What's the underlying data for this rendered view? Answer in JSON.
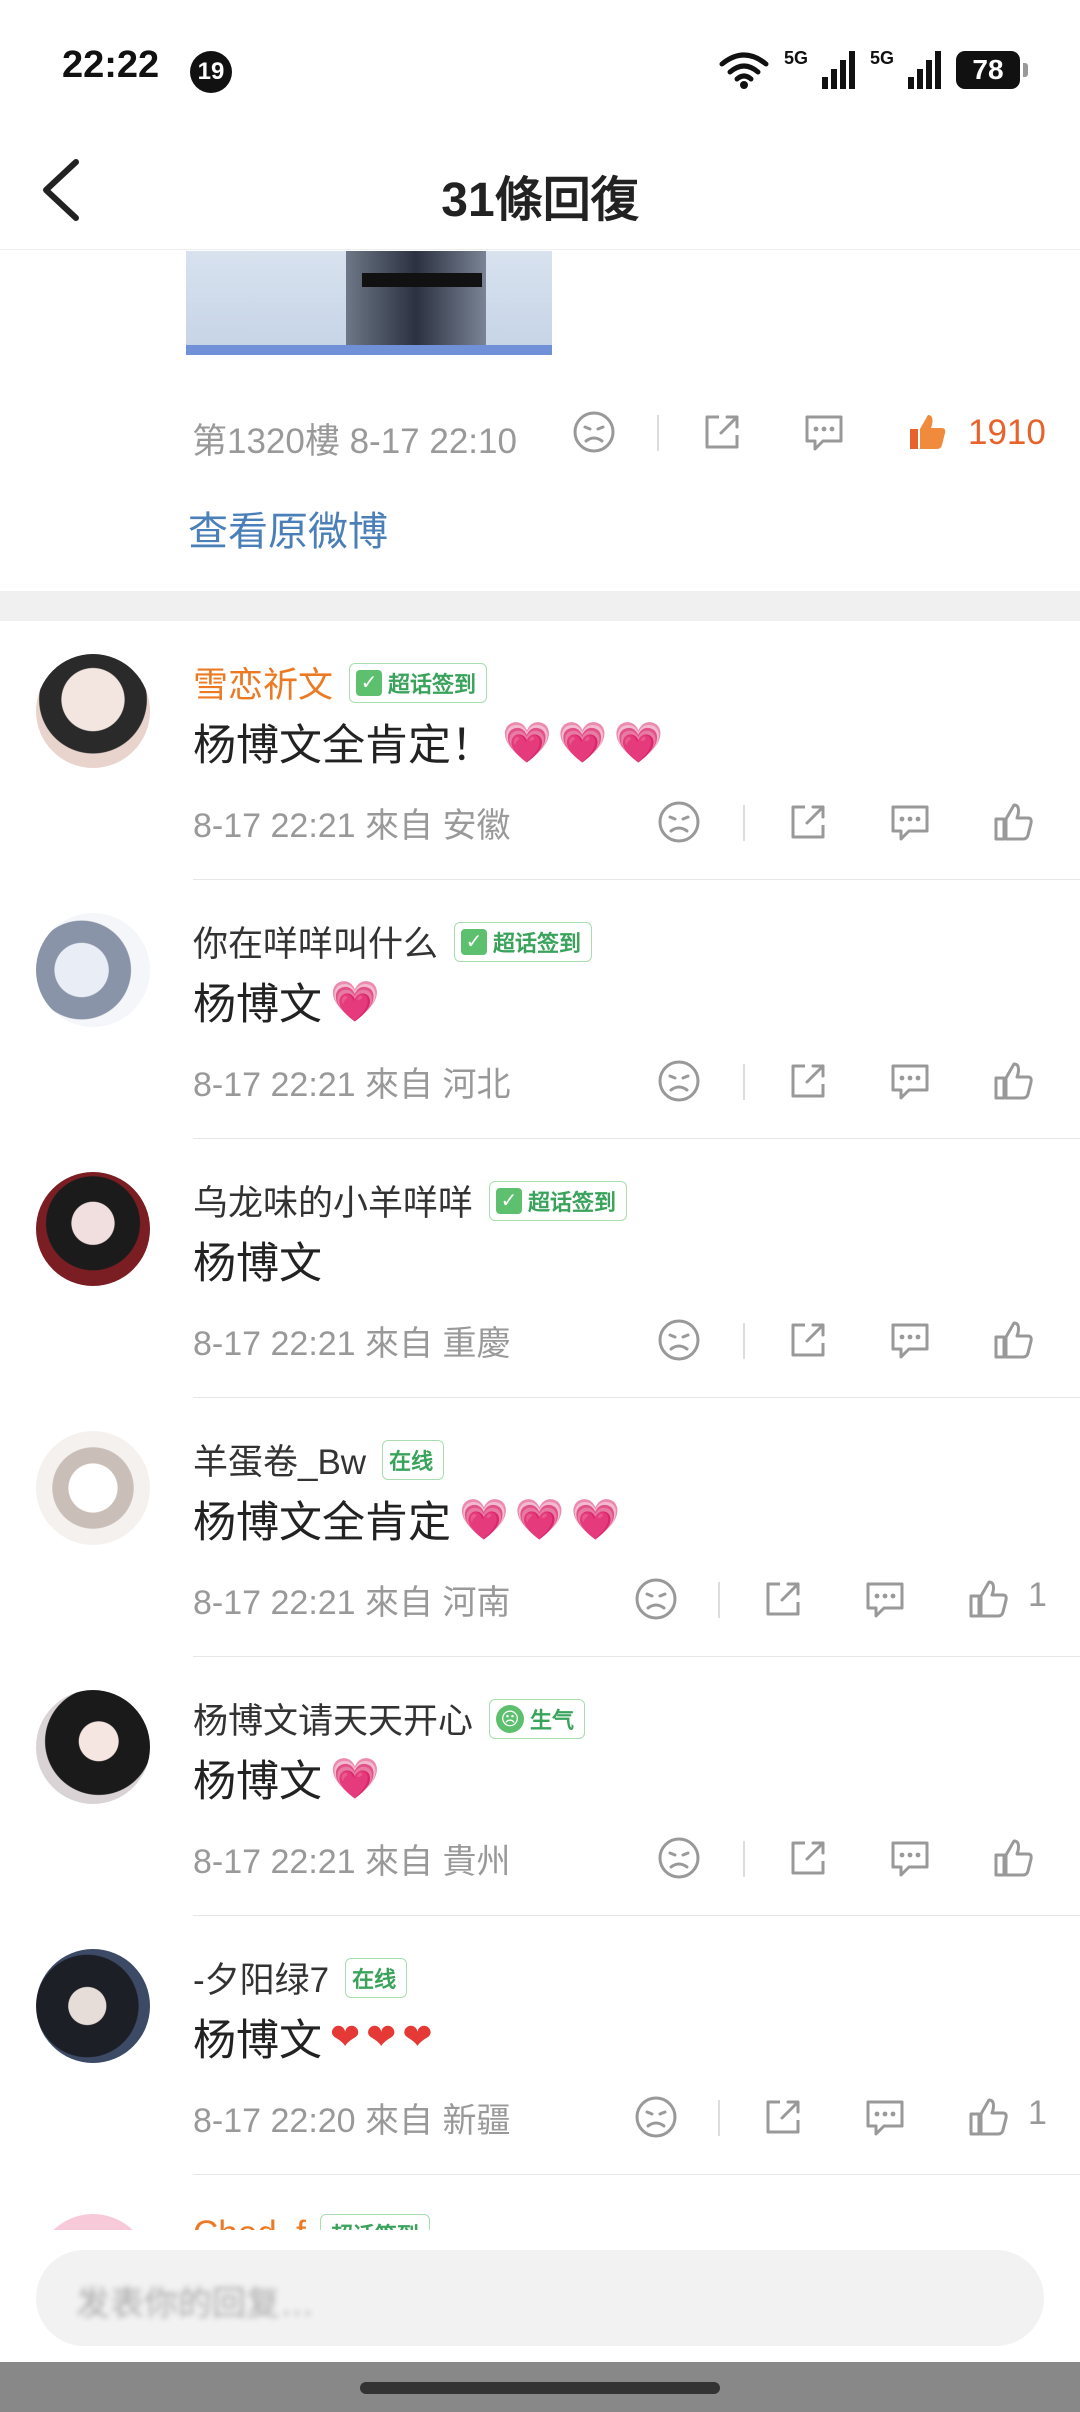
{
  "status_bar": {
    "time": "22:22",
    "notification_count": "19",
    "network_1": "5G",
    "network_2": "5G",
    "battery": "78"
  },
  "nav": {
    "title": "31條回復"
  },
  "original_post": {
    "floor_info": "第1320樓 8-17 22:10",
    "like_count": "1910",
    "view_original": "查看原微博"
  },
  "comments": [
    {
      "username": "雪恋祈文",
      "badge": "超话签到",
      "text": "杨博文全肯定！",
      "hearts": "💗💗💗",
      "meta": "8-17 22:21 來自 安徽",
      "likes": ""
    },
    {
      "username": "你在咩咩叫什么",
      "badge": "超话签到",
      "text": "杨博文",
      "hearts": "💗",
      "meta": "8-17 22:21 來自 河北",
      "likes": ""
    },
    {
      "username": "乌龙味的小羊咩咩",
      "badge": "超话签到",
      "text": "杨博文",
      "hearts": "",
      "meta": "8-17 22:21 來自 重慶",
      "likes": ""
    },
    {
      "username": "羊蛋卷_Bw",
      "badge": "在线",
      "text": "杨博文全肯定",
      "hearts": "💗💗💗",
      "meta": "8-17 22:21 來自 河南",
      "likes": "1"
    },
    {
      "username": "杨博文请天天开心",
      "badge": "生气",
      "text": "杨博文",
      "hearts": "💗",
      "meta": "8-17 22:21 來自 貴州",
      "likes": ""
    },
    {
      "username": "-夕阳绿7",
      "badge": "在线",
      "text": "杨博文",
      "hearts": "❤❤❤",
      "meta": "8-17 22:20 來自 新疆",
      "likes": "1"
    }
  ],
  "partial_comment": {
    "username": "Chod_f",
    "badge": "超话签到"
  },
  "input": {
    "placeholder": "发表你的回复…"
  },
  "colors": {
    "accent_orange": "#e8622b",
    "link_blue": "#4a7fb8",
    "badge_green": "#3aa35b"
  },
  "icons": [
    "back-icon",
    "wifi-icon",
    "signal-icon",
    "battery-icon",
    "dislike-icon",
    "share-icon",
    "comment-icon",
    "like-icon"
  ]
}
